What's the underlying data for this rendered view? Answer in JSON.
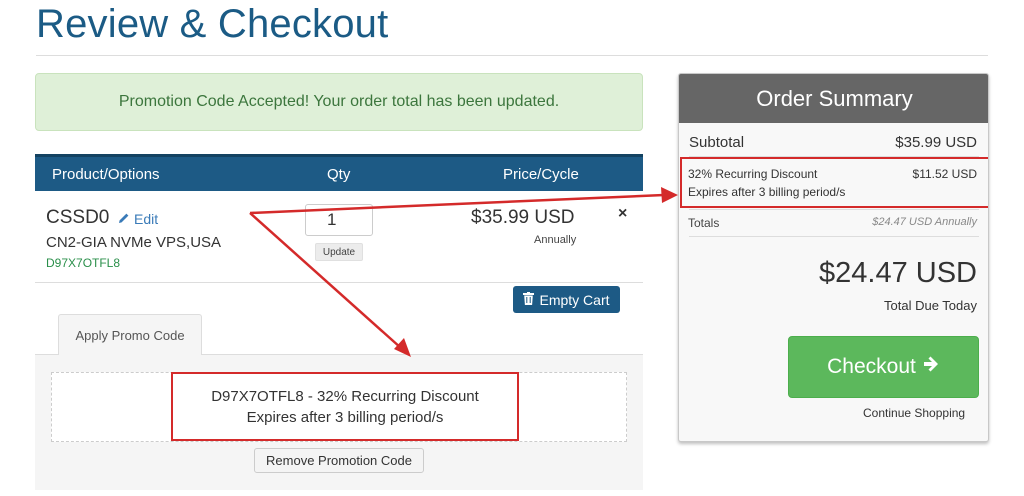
{
  "page": {
    "title": "Review & Checkout"
  },
  "alert": {
    "text": "Promotion Code Accepted! Your order total has been updated."
  },
  "cart": {
    "headers": {
      "product": "Product/Options",
      "qty": "Qty",
      "price": "Price/Cycle"
    },
    "item": {
      "name": "CSSD0",
      "edit_label": "Edit",
      "description": "CN2-GIA NVMe VPS,USA",
      "code": "D97X7OTFL8",
      "qty": "1",
      "update_label": "Update",
      "price": "$35.99 USD",
      "cycle": "Annually",
      "remove_symbol": "×"
    },
    "empty_cart_label": "Empty Cart"
  },
  "promo": {
    "tab_label": "Apply Promo Code",
    "line1": "D97X7OTFL8 - 32% Recurring Discount",
    "line2": "Expires after 3 billing period/s",
    "remove_label": "Remove Promotion Code"
  },
  "summary": {
    "title": "Order Summary",
    "subtotal_label": "Subtotal",
    "subtotal_value": "$35.99 USD",
    "discount_line1": "32% Recurring Discount",
    "discount_line2": "Expires after 3 billing period/s",
    "discount_value": "$11.52 USD",
    "totals_label": "Totals",
    "totals_value": "$24.47 USD Annually",
    "grand_total": "$24.47 USD",
    "due_label": "Total Due Today",
    "checkout_label": "Checkout",
    "continue_label": "Continue Shopping"
  },
  "colors": {
    "brand_blue": "#1d5a85",
    "success_green": "#5cb85c",
    "highlight_red": "#d42a2a",
    "alert_bg": "#dff0d8"
  },
  "icons": {
    "edit": "pencil-icon",
    "empty_cart": "trash-icon",
    "checkout": "arrow-right-icon",
    "remove": "close-icon"
  }
}
